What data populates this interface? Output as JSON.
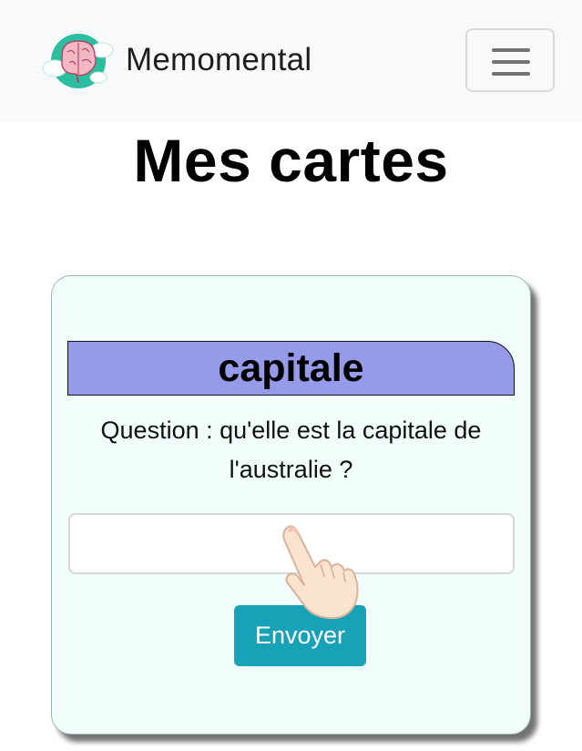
{
  "header": {
    "brand_name": "Memomental",
    "logo_icon": "brain-cloud-logo",
    "menu_icon": "hamburger-menu-icon"
  },
  "page": {
    "title": "Mes cartes"
  },
  "card": {
    "header_label": "capitale",
    "question_text": "Question : qu'elle est la capitale de l'australie ?",
    "answer_value": "",
    "answer_placeholder": "",
    "submit_label": "Envoyer"
  },
  "overlay": {
    "tap_icon": "pointing-hand-icon"
  },
  "colors": {
    "navbar_bg": "#f8f9fa",
    "card_bg": "#f1fefb",
    "card_header_bg": "#959ae9",
    "button_bg": "#17a2b8",
    "logo_teal": "#2bbfa0",
    "logo_pink": "#f3b8c4"
  }
}
